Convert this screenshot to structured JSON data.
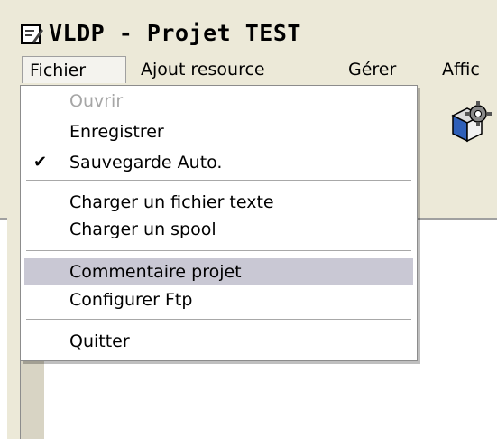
{
  "window": {
    "title": "VLDP - Projet TEST",
    "title_icon": "document-edit-icon"
  },
  "menubar": {
    "items": [
      {
        "label": "Fichier",
        "active": true
      },
      {
        "label": "Ajout resource"
      },
      {
        "label": "Gérer"
      },
      {
        "label": "Affic"
      }
    ]
  },
  "toolbar": {
    "icon": "gear-cube-icon"
  },
  "fichier_menu": {
    "items": [
      {
        "label": "Ouvrir",
        "disabled": true
      },
      {
        "label": "Enregistrer"
      },
      {
        "label": "Sauvegarde Auto.",
        "checked": true,
        "check_glyph": "✔"
      },
      {
        "label": "Charger un fichier texte"
      },
      {
        "label": "Charger un spool"
      },
      {
        "label": "Commentaire projet",
        "highlighted": true
      },
      {
        "label": "Configurer Ftp"
      },
      {
        "label": "Quitter"
      }
    ]
  }
}
